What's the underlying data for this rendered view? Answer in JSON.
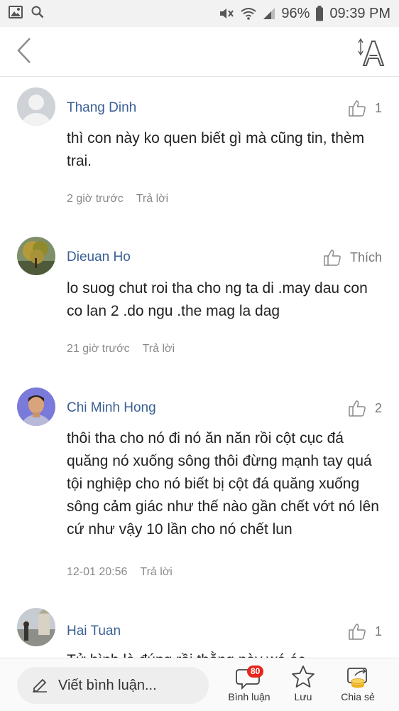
{
  "status_bar": {
    "battery": "96%",
    "time": "09:39 PM",
    "icons": [
      "image-icon",
      "search-icon",
      "mute-icon",
      "wifi-icon",
      "signal-icon",
      "battery-icon"
    ]
  },
  "header": {
    "back_icon": "chevron-left-icon",
    "font_size_icon": "font-size-icon"
  },
  "comments": [
    {
      "author": "Thang Dinh",
      "avatar": "default-avatar",
      "likes": "1",
      "text": "thì con này ko quen biết gì mà cũng tin, thèm trai.",
      "time": "2 giờ trước",
      "reply": "Trả lời"
    },
    {
      "author": "Dieuan Ho",
      "avatar": "tree-photo-avatar",
      "likes": "Thích",
      "text": "lo suog chut roi tha cho ng ta di .may dau con co lan 2 .do ngu .the mag la dag",
      "time": "21 giờ trước",
      "reply": "Trả lời"
    },
    {
      "author": "Chi Minh Hong",
      "avatar": "person-photo-avatar",
      "likes": "2",
      "text": "thôi tha cho nó đi nó ăn năn rồi cột cục đá quăng nó xuống sông thôi đừng mạnh tay quá tội nghiệp cho nó biết bị cột đá quăng xuống sông cảm giác như thế nào gần chết vớt nó lên cứ như vậy 10 lần cho nó chết lun",
      "time": "12-01 20:56",
      "reply": "Trả lời"
    },
    {
      "author": "Hai Tuan",
      "avatar": "landmark-photo-avatar",
      "likes": "1",
      "text": "Tử hình là đúng rồi thằng này wá ác",
      "time": "",
      "reply": ""
    }
  ],
  "bottom_bar": {
    "write_placeholder": "Viết bình luận...",
    "comments_label": "Bình luận",
    "comments_badge": "80",
    "save_label": "Lưu",
    "share_label": "Chia sẻ",
    "accent": "#e8261c",
    "share_accent": "#f2b21a"
  },
  "colors": {
    "author_name": "#3a5f94",
    "meta_text": "#8a8a8a"
  }
}
